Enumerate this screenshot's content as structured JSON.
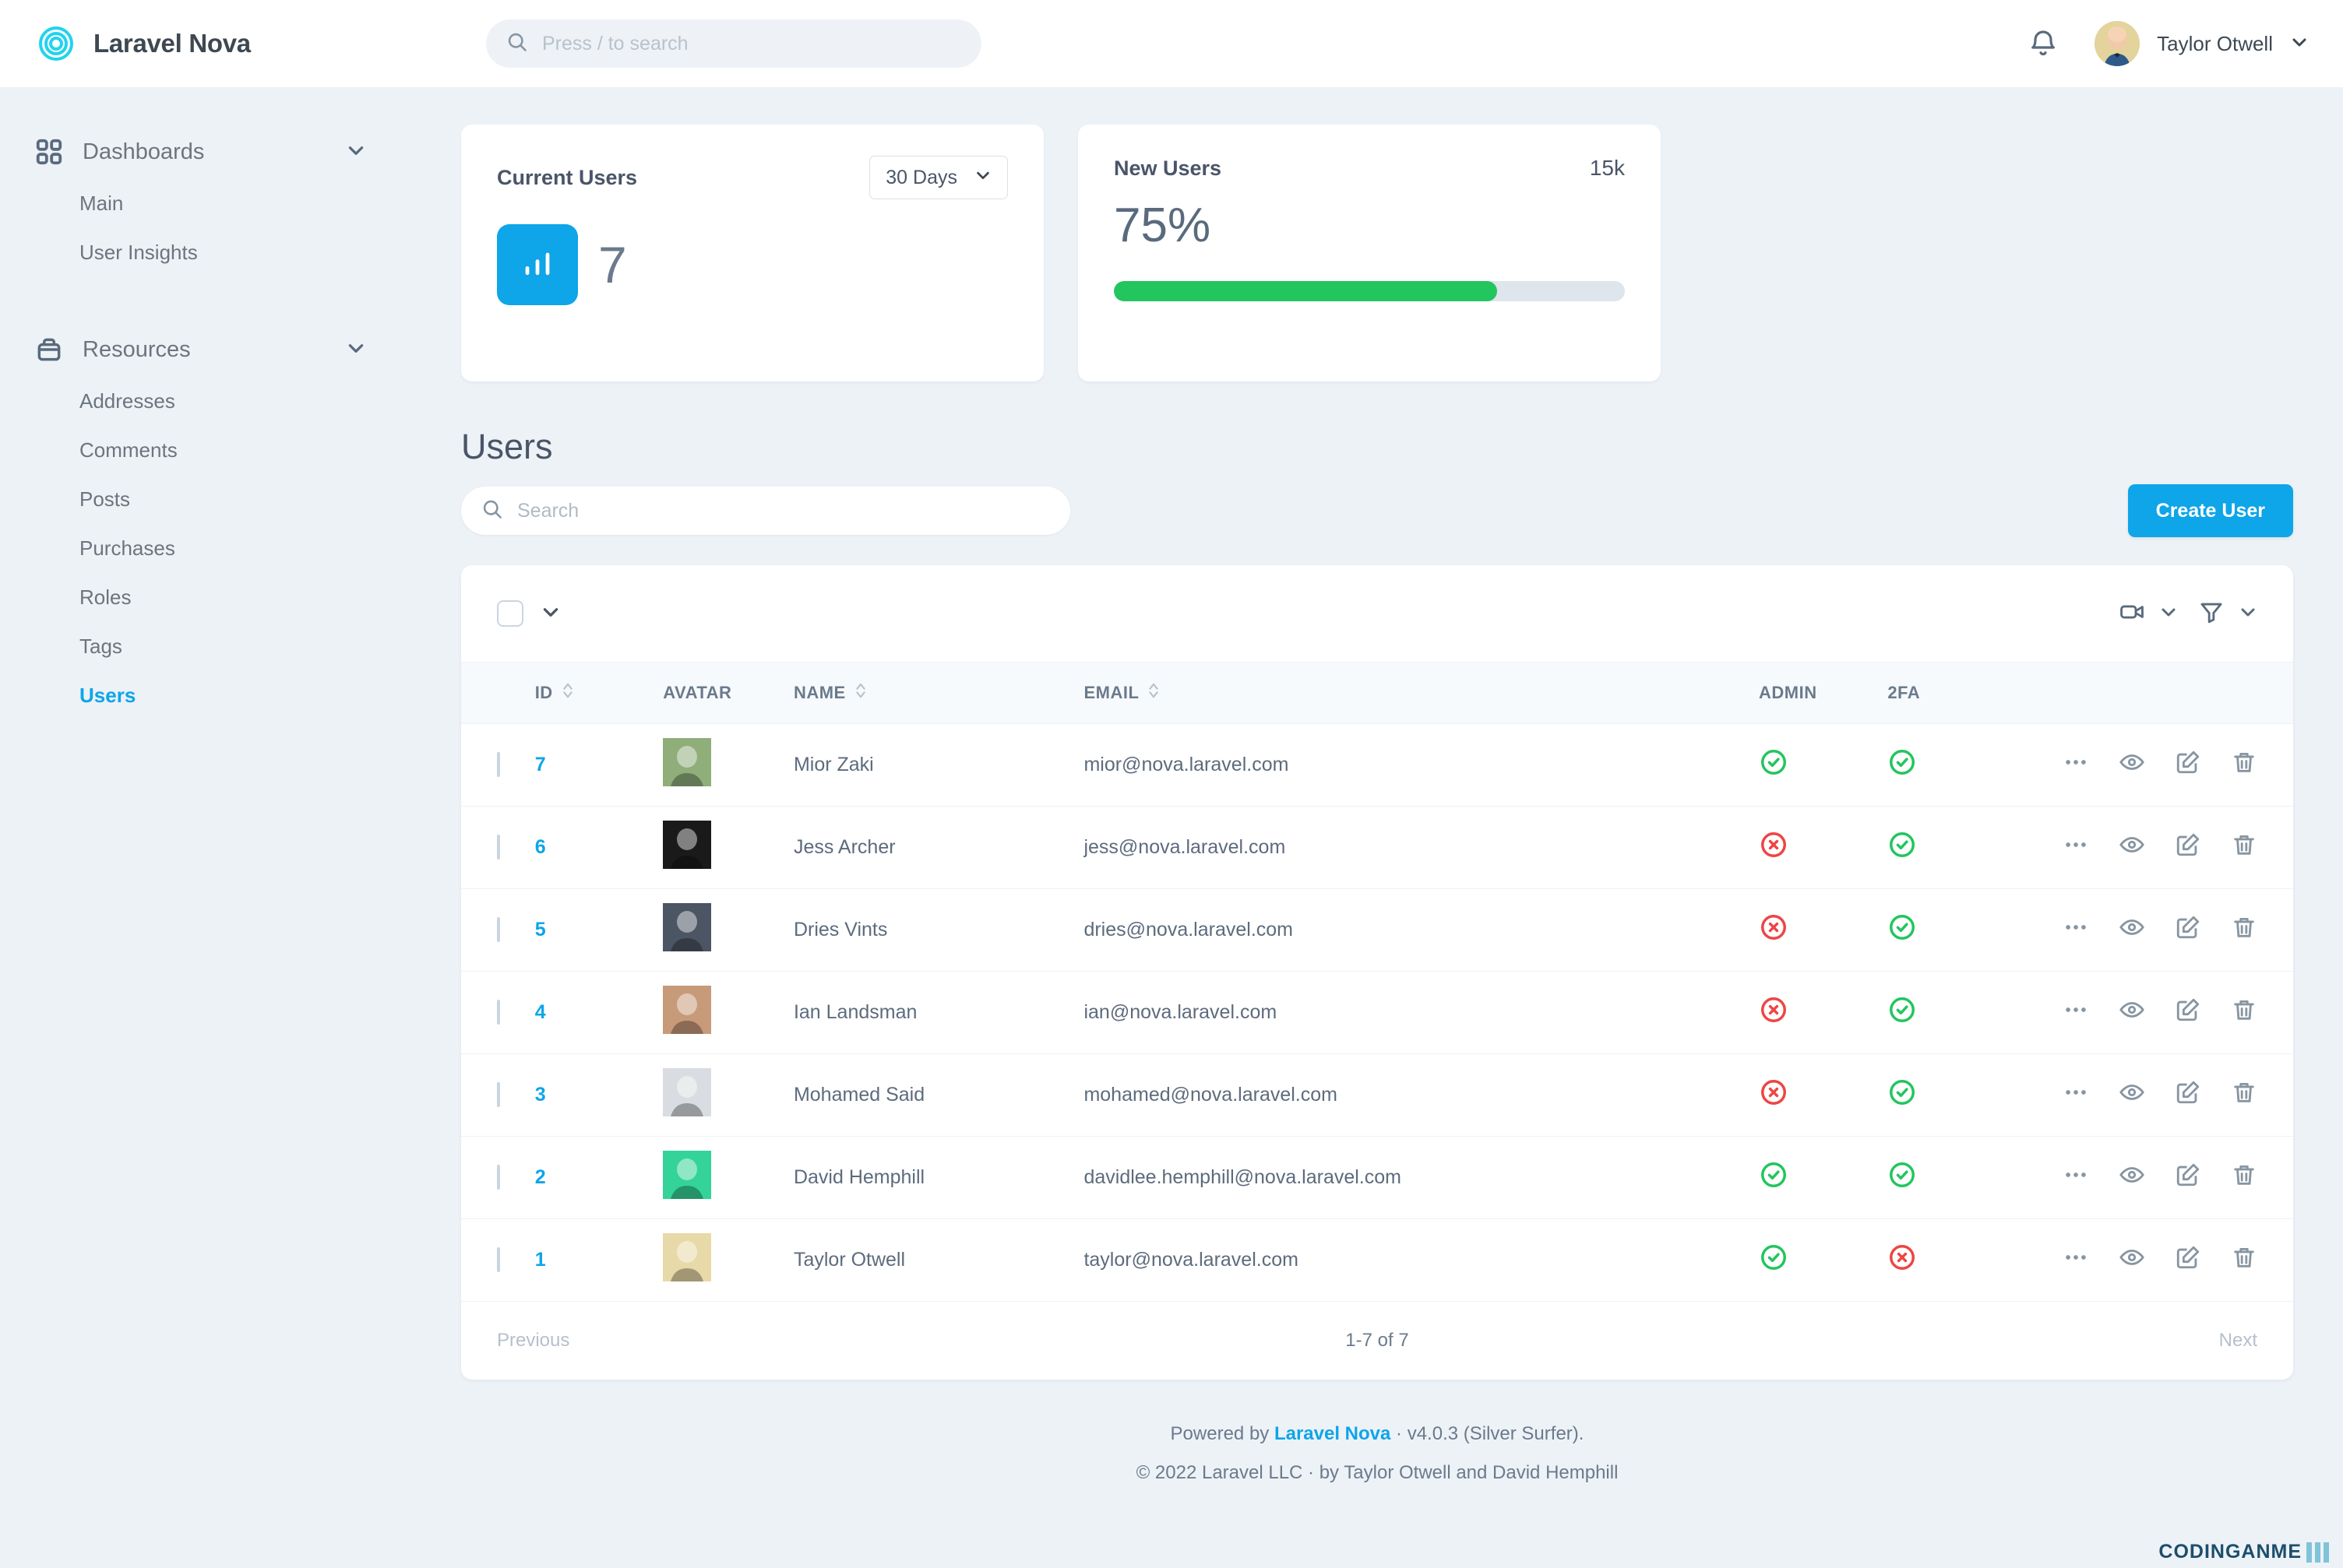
{
  "app": {
    "brand": "Laravel Nova",
    "logo_color": "#22d3ee"
  },
  "topbar": {
    "search_placeholder": "Press / to search",
    "notifications_icon": "bell-icon",
    "user_name": "Taylor Otwell",
    "user_menu_icon": "chevron-down-icon"
  },
  "sidebar": {
    "groups": [
      {
        "label": "Dashboards",
        "icon": "grid-icon",
        "items": [
          {
            "label": "Main",
            "active": false
          },
          {
            "label": "User Insights",
            "active": false
          }
        ]
      },
      {
        "label": "Resources",
        "icon": "archive-box-icon",
        "items": [
          {
            "label": "Addresses",
            "active": false
          },
          {
            "label": "Comments",
            "active": false
          },
          {
            "label": "Posts",
            "active": false
          },
          {
            "label": "Purchases",
            "active": false
          },
          {
            "label": "Roles",
            "active": false
          },
          {
            "label": "Tags",
            "active": false
          },
          {
            "label": "Users",
            "active": true
          }
        ]
      }
    ]
  },
  "metrics": [
    {
      "title": "Current Users",
      "range": "30 Days",
      "value": "7",
      "icon": "bar-chart-icon",
      "badge_color": "#0ea5e9"
    },
    {
      "title": "New Users",
      "target": "15k",
      "value": "75%",
      "progress_percent": 75,
      "bar_color": "#22c55e"
    }
  ],
  "page": {
    "title": "Users",
    "search_placeholder": "Search",
    "create_label": "Create User"
  },
  "toolbar": {
    "select_all_icon": "checkbox-icon",
    "select_all_chevron": "chevron-down-icon",
    "actions_icon": "video-camera-icon",
    "actions_chevron": "chevron-down-icon",
    "filter_icon": "filter-funnel-icon",
    "filter_chevron": "chevron-down-icon"
  },
  "table": {
    "columns": [
      {
        "key": "id",
        "label": "ID",
        "sortable": true
      },
      {
        "key": "avatar",
        "label": "AVATAR",
        "sortable": false
      },
      {
        "key": "name",
        "label": "NAME",
        "sortable": true
      },
      {
        "key": "email",
        "label": "EMAIL",
        "sortable": true
      },
      {
        "key": "admin",
        "label": "ADMIN",
        "sortable": false
      },
      {
        "key": "twofa",
        "label": "2FA",
        "sortable": false
      }
    ],
    "row_actions": [
      "ellipsis-icon",
      "eye-icon",
      "pencil-icon",
      "trash-icon"
    ],
    "rows": [
      {
        "id": "7",
        "name": "Mior Zaki",
        "email": "mior@nova.laravel.com",
        "admin": true,
        "twofa": true,
        "avatar_bg": "#8fae7a"
      },
      {
        "id": "6",
        "name": "Jess Archer",
        "email": "jess@nova.laravel.com",
        "admin": false,
        "twofa": true,
        "avatar_bg": "#1a1a1a"
      },
      {
        "id": "5",
        "name": "Dries Vints",
        "email": "dries@nova.laravel.com",
        "admin": false,
        "twofa": true,
        "avatar_bg": "#4b5563"
      },
      {
        "id": "4",
        "name": "Ian Landsman",
        "email": "ian@nova.laravel.com",
        "admin": false,
        "twofa": true,
        "avatar_bg": "#c79a7a"
      },
      {
        "id": "3",
        "name": "Mohamed Said",
        "email": "mohamed@nova.laravel.com",
        "admin": false,
        "twofa": true,
        "avatar_bg": "#d9dde1"
      },
      {
        "id": "2",
        "name": "David Hemphill",
        "email": "davidlee.hemphill@nova.laravel.com",
        "admin": true,
        "twofa": true,
        "avatar_bg": "#34d399"
      },
      {
        "id": "1",
        "name": "Taylor Otwell",
        "email": "taylor@nova.laravel.com",
        "admin": true,
        "twofa": false,
        "avatar_bg": "#e8d9a8"
      }
    ]
  },
  "pagination": {
    "previous": "Previous",
    "count": "1-7 of 7",
    "next": "Next"
  },
  "footer": {
    "powered_prefix": "Powered by ",
    "powered_brand": "Laravel Nova",
    "powered_suffix": " · v4.0.3 (Silver Surfer).",
    "copyright": "© 2022 Laravel LLC · by Taylor Otwell and David Hemphill"
  },
  "watermark": {
    "text": "CODINGANME"
  },
  "colors": {
    "accent": "#0ea5e9",
    "success": "#22c55e",
    "danger": "#ef4444",
    "page_bg": "#edf2f7"
  }
}
